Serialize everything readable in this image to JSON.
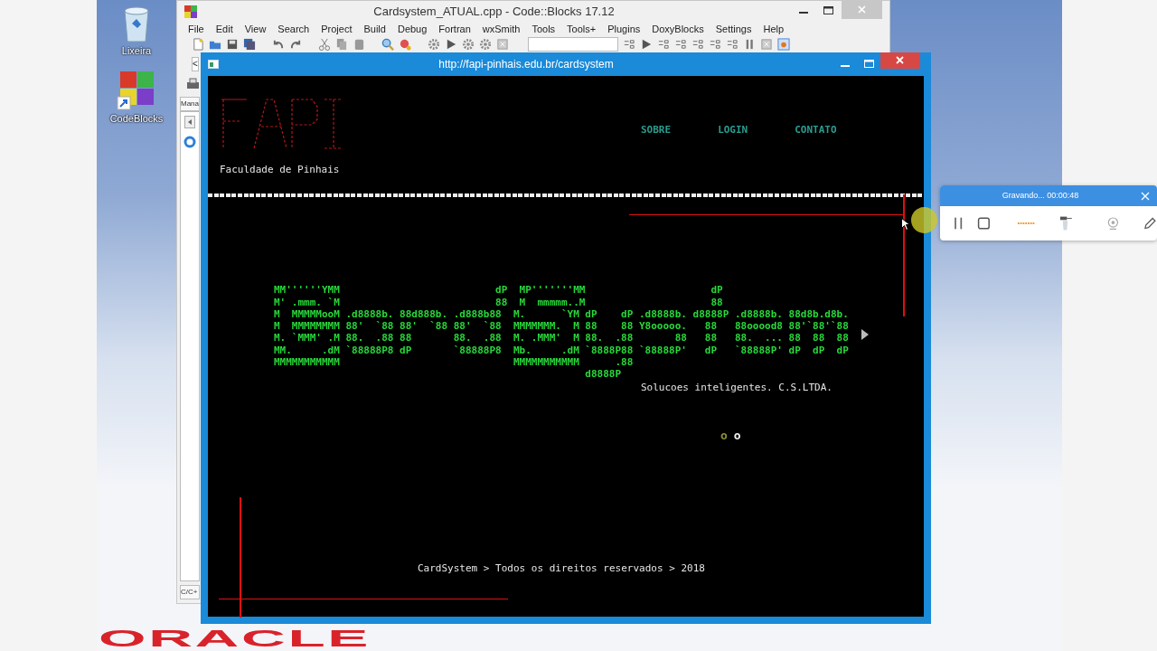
{
  "desktop": {
    "icons": [
      {
        "label": "Lixeira",
        "kind": "bin"
      },
      {
        "label": "CodeBlocks",
        "kind": "app"
      }
    ],
    "wallpaper_text": "ORACLE"
  },
  "ide_window": {
    "title": "Cardsystem_ATUAL.cpp - Code::Blocks 17.12",
    "menu": [
      "File",
      "Edit",
      "View",
      "Search",
      "Project",
      "Build",
      "Debug",
      "Fortran",
      "wxSmith",
      "Tools",
      "Tools+",
      "Plugins",
      "DoxyBlocks",
      "Settings",
      "Help"
    ],
    "toolbar_combo": "<",
    "panel_tab": "Mana",
    "panel_footer": "C/C+"
  },
  "console_window": {
    "title": "http://fapi-pinhais.edu.br/cardsystem",
    "nav": [
      "SOBRE",
      "LOGIN",
      "CONTATO"
    ],
    "subtitle": "Faculdade de Pinhais",
    "ascii_art": [
      "MM''''''YMM                          dP  MP'''''''MM                     dP",
      "M' .mmm. `M                          88  M  mmmmm..M                     88",
      "M  MMMMMooM .d8888b. 88d888b. .d888b88  M.      `YM dP    dP .d8888b. d8888P .d8888b. 88d8b.d8b.",
      "M  MMMMMMMM 88'  `88 88'  `88 88'  `88  MMMMMMM.  M 88    88 Y8ooooo.   88   88ooood8 88'`88'`88",
      "M. `MMM' .M 88.  .88 88       88.  .88  M. .MMM'  M 88.  .88       88   88   88.  ... 88  88  88",
      "MM.     .dM `88888P8 dP       `88888P8  Mb.     .dM `8888P88 `88888P'   dP   `88888P' dP  dP  dP",
      "MMMMMMMMMMM                             MMMMMMMMMMM      .88",
      "                                                    d8888P"
    ],
    "tagline": "Solucoes inteligentes. C.S.LTDA.",
    "dots": [
      {
        "text": "o",
        "color": "#8c8c3c"
      },
      {
        "text": "o",
        "color": "#f0f0f0"
      }
    ],
    "footer": "CardSystem > Todos os direitos reservados > 2018"
  },
  "recorder": {
    "title": "Gravando... 00:00:48"
  }
}
